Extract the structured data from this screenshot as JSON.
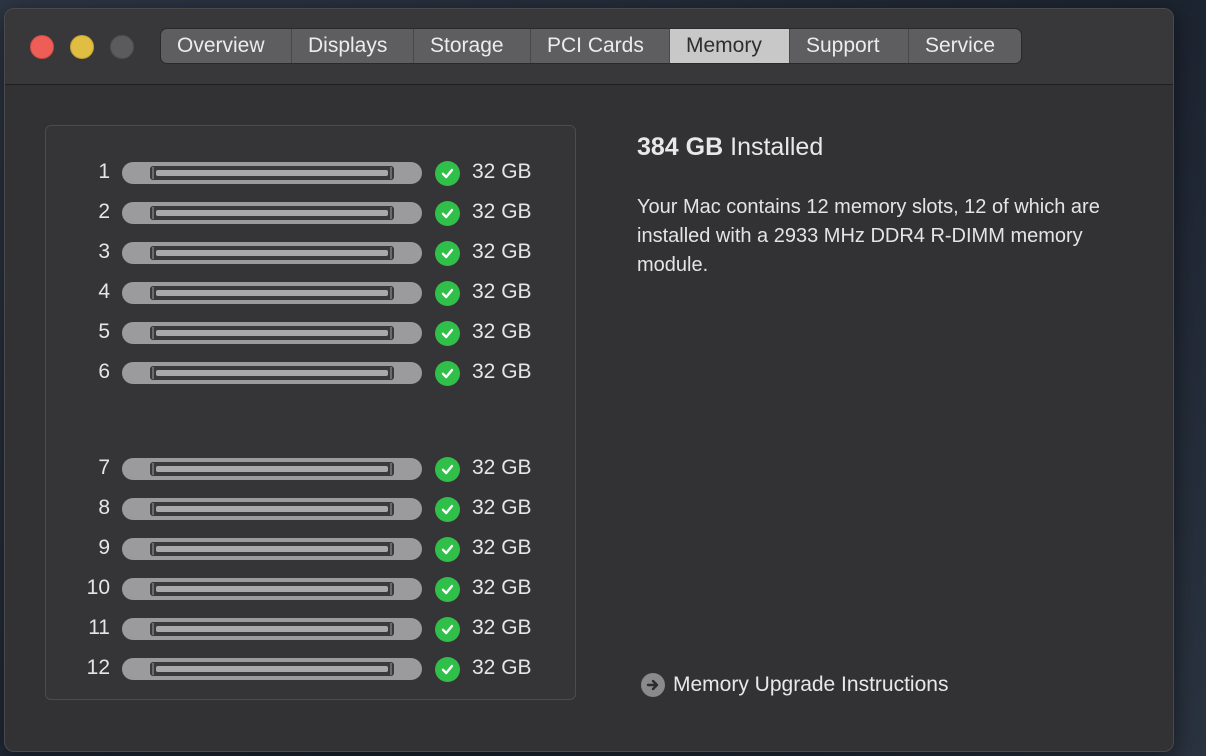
{
  "window": {
    "tabs": [
      {
        "label": "Overview",
        "active": false
      },
      {
        "label": "Displays",
        "active": false
      },
      {
        "label": "Storage",
        "active": false
      },
      {
        "label": "PCI Cards",
        "active": false
      },
      {
        "label": "Memory",
        "active": true
      },
      {
        "label": "Support",
        "active": false
      },
      {
        "label": "Service",
        "active": false
      }
    ]
  },
  "memory": {
    "total_amount": "384 GB",
    "total_suffix": "Installed",
    "description": "Your Mac contains 12 memory slots, 12 of which are installed with a 2933 MHz DDR4 R-DIMM memory module.",
    "upgrade_link": "Memory Upgrade Instructions",
    "slots": [
      {
        "number": "1",
        "size": "32 GB",
        "status": "ok"
      },
      {
        "number": "2",
        "size": "32 GB",
        "status": "ok"
      },
      {
        "number": "3",
        "size": "32 GB",
        "status": "ok"
      },
      {
        "number": "4",
        "size": "32 GB",
        "status": "ok"
      },
      {
        "number": "5",
        "size": "32 GB",
        "status": "ok"
      },
      {
        "number": "6",
        "size": "32 GB",
        "status": "ok"
      },
      {
        "number": "7",
        "size": "32 GB",
        "status": "ok"
      },
      {
        "number": "8",
        "size": "32 GB",
        "status": "ok"
      },
      {
        "number": "9",
        "size": "32 GB",
        "status": "ok"
      },
      {
        "number": "10",
        "size": "32 GB",
        "status": "ok"
      },
      {
        "number": "11",
        "size": "32 GB",
        "status": "ok"
      },
      {
        "number": "12",
        "size": "32 GB",
        "status": "ok"
      }
    ]
  },
  "colors": {
    "close": "#ee5e57",
    "minimize": "#e0be42",
    "zoom_disabled": "#5b5b5d",
    "status_ok": "#30c04a"
  },
  "icons": {
    "status": "checkmark-circle-icon",
    "link": "arrow-circle-right-icon"
  }
}
